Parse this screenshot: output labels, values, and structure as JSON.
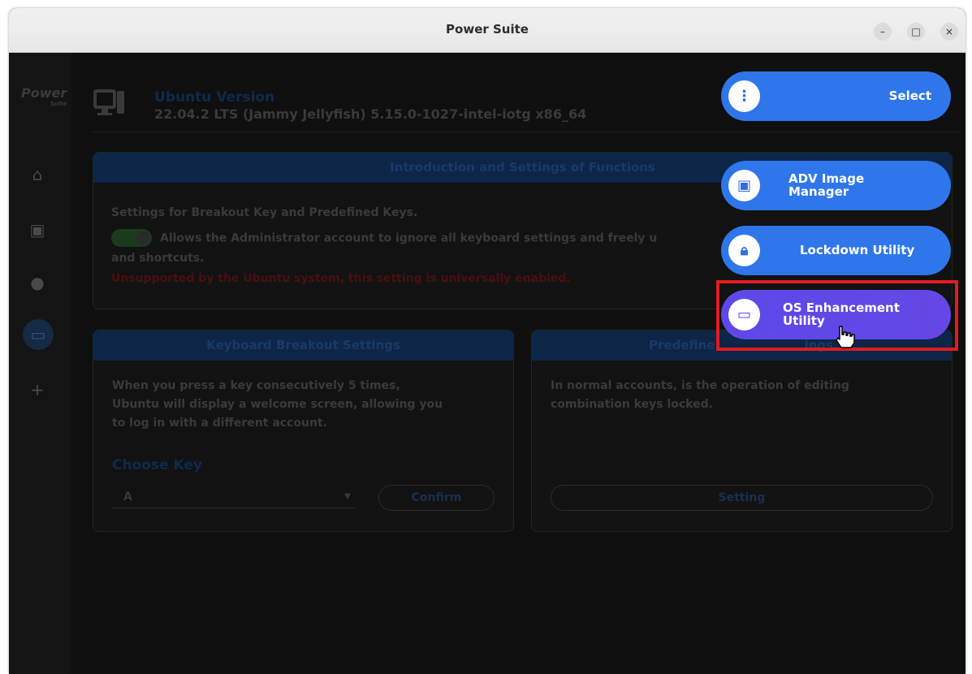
{
  "window": {
    "title": "Power Suite",
    "controls": {
      "minimize": "–",
      "maximize": "□",
      "close": "×"
    }
  },
  "sidebar": {
    "logo": "Power",
    "logo_sub": "Suite",
    "items": [
      {
        "name": "home-icon",
        "glyph": "⌂"
      },
      {
        "name": "device-icon",
        "glyph": "▣"
      },
      {
        "name": "lock-icon",
        "glyph": "●"
      },
      {
        "name": "keyboard-icon",
        "glyph": "▭"
      },
      {
        "name": "add-icon",
        "glyph": "+"
      }
    ]
  },
  "header": {
    "version_title": "Ubuntu Version",
    "version_value": "22.04.2 LTS (Jammy Jellyfish) 5.15.0-1027-intel-iotg x86_64"
  },
  "intro_panel": {
    "title": "Introduction and Settings of Functions",
    "heading": "Settings for Breakout Key and Predefined Keys.",
    "description_line1": "Allows the Administrator account to ignore all keyboard settings and freely u",
    "description_line2": "and shortcuts.",
    "warning": "Unsupported by the Ubuntu system, this setting is universally enabled."
  },
  "breakout_panel": {
    "title": "Keyboard Breakout Settings",
    "line1": "When you press a key consecutively 5 times,",
    "line2": "Ubuntu will display a welcome screen, allowing you",
    "line3": "to log in with a different account.",
    "choose_key_label": "Choose Key",
    "selected_key": "A",
    "confirm_label": "Confirm"
  },
  "predefined_panel": {
    "title": "Predefine",
    "title_tail": "ings",
    "text_line1": "In normal accounts, is the operation of editing",
    "text_line2": "combination keys locked.",
    "setting_label": "Setting"
  },
  "menu": {
    "select_label": "Select",
    "items": [
      {
        "line1": "ADV Image",
        "line2": "Manager"
      },
      {
        "line1": "Lockdown Utility",
        "line2": ""
      },
      {
        "line1": "OS Enhancement",
        "line2": "Utility"
      }
    ]
  },
  "colors": {
    "accent_blue": "#2f76ea",
    "accent_purple": "#5d49e8",
    "highlight_red": "#e21b22"
  }
}
